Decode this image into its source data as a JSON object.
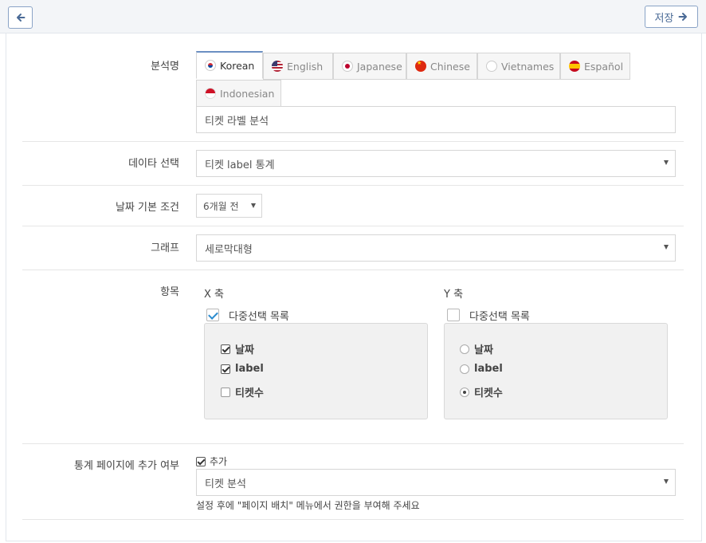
{
  "toolbar": {
    "save_label": "저장"
  },
  "analysis_name": {
    "label": "분석명",
    "tabs": [
      {
        "label": "Korean",
        "flag": "korea-flag-icon"
      },
      {
        "label": "English",
        "flag": "usa-flag-icon"
      },
      {
        "label": "Japanese",
        "flag": "japan-flag-icon"
      },
      {
        "label": "Chinese",
        "flag": "china-flag-icon"
      },
      {
        "label": "Vietnames",
        "flag": "vietnam-flag-icon"
      },
      {
        "label": "Español",
        "flag": "spain-flag-icon"
      },
      {
        "label": "Indonesian",
        "flag": "indonesia-flag-icon"
      }
    ],
    "value": "티켓 라벨 분석"
  },
  "data_select": {
    "label": "데이타 선택",
    "value": "티켓 label 통계"
  },
  "date_condition": {
    "label": "날짜 기본 조건",
    "value": "6개월 전"
  },
  "graph": {
    "label": "그래프",
    "value": "세로막대형"
  },
  "items": {
    "label": "항목",
    "x_axis": {
      "title": "X 축",
      "multi_select_label": "다중선택 목록",
      "multi_select_checked": true,
      "options": [
        {
          "label": "날짜",
          "checked": true
        },
        {
          "label": "label",
          "checked": true
        },
        {
          "label": "티켓수",
          "checked": false
        }
      ]
    },
    "y_axis": {
      "title": "Y 축",
      "multi_select_label": "다중선택 목록",
      "multi_select_checked": false,
      "options": [
        {
          "label": "날짜",
          "selected": false
        },
        {
          "label": "label",
          "selected": false
        },
        {
          "label": "티켓수",
          "selected": true
        }
      ]
    }
  },
  "stats_page": {
    "label": "통계 페이지에 추가 여부",
    "add_label": "추가",
    "add_checked": true,
    "select_value": "티켓 분석",
    "hint": "설정 후에 \"페이지 배치\" 메뉴에서 권한을 부여해 주세요"
  }
}
